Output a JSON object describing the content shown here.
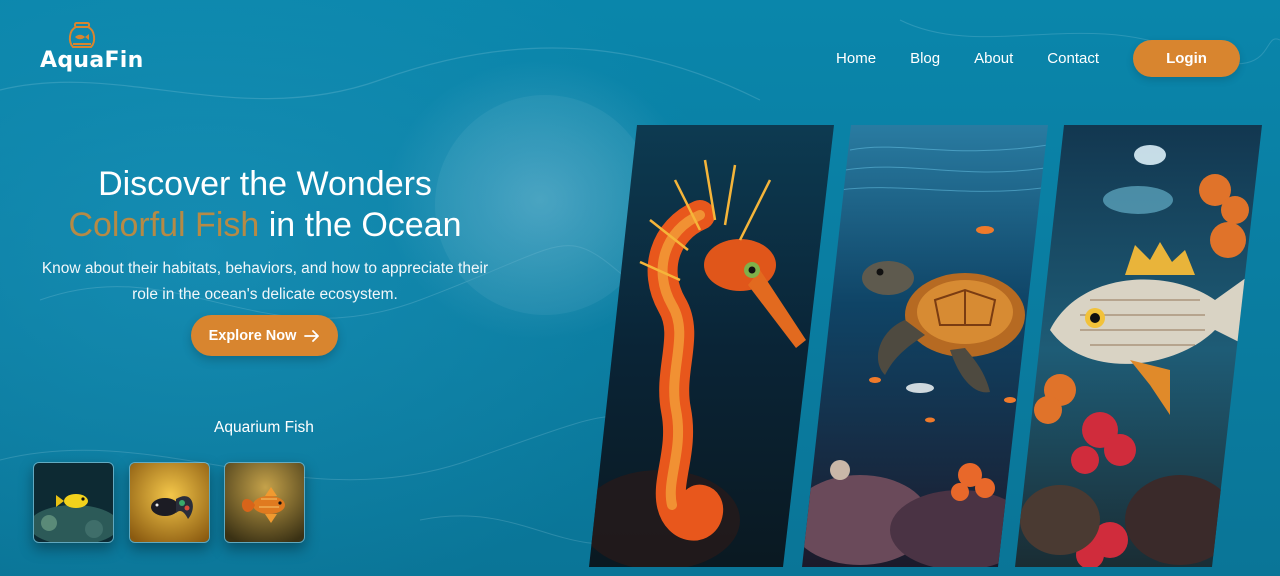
{
  "brand": {
    "name": "AquaFin",
    "logo_icon": "fishbowl-icon"
  },
  "nav": {
    "links": [
      "Home",
      "Blog",
      "About",
      "Contact"
    ],
    "login_label": "Login"
  },
  "hero": {
    "title_line1": "Discover the Wonders",
    "title_accent": "Colorful Fish",
    "title_rest": " in the Ocean",
    "subtitle_line1": "Know about their habitats, behaviors, and how to appreciate their",
    "subtitle_line2": "role in the ocean's delicate ecosystem.",
    "cta_label": "Explore Now"
  },
  "aquarium": {
    "title": "Aquarium Fish",
    "thumbnails": [
      "yellow-fish-thumbnail",
      "betta-fish-thumbnail",
      "orange-fish-thumbnail"
    ]
  },
  "gallery": [
    "seahorse-image",
    "sea-turtle-image",
    "reef-fish-image"
  ],
  "colors": {
    "accent": "#d8852f",
    "accent_text": "#b68a45",
    "background": "#0a80a5"
  }
}
